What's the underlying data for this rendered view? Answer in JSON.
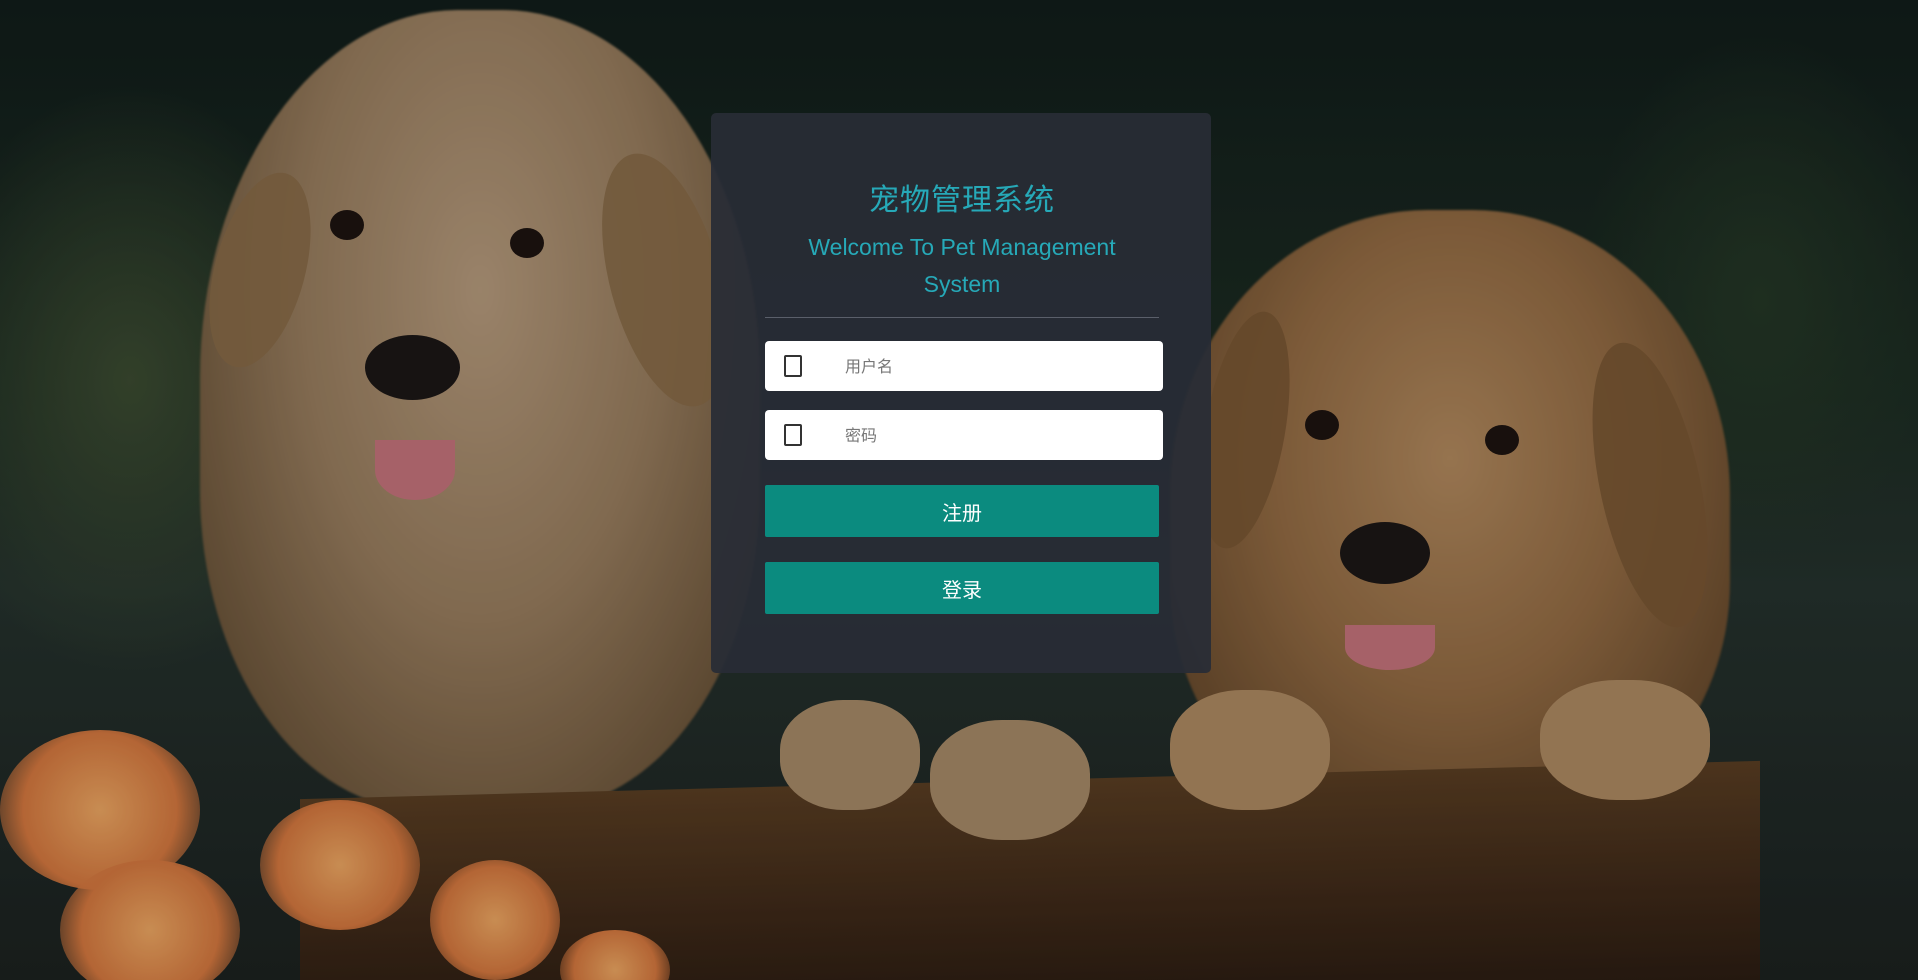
{
  "page": {
    "background_image": "two golden retriever puppies on a wooden bench with orange flowers"
  },
  "login": {
    "title": "宠物管理系统",
    "subtitle": "Welcome To Pet Management System",
    "username": {
      "icon": "user-icon",
      "placeholder": "用户名",
      "value": ""
    },
    "password": {
      "icon": "lock-icon",
      "placeholder": "密码",
      "value": ""
    },
    "register_label": "注册",
    "login_label": "登录"
  },
  "colors": {
    "accent": "#26a9b8",
    "button": "#0b8b7f",
    "panel": "#282c36"
  }
}
